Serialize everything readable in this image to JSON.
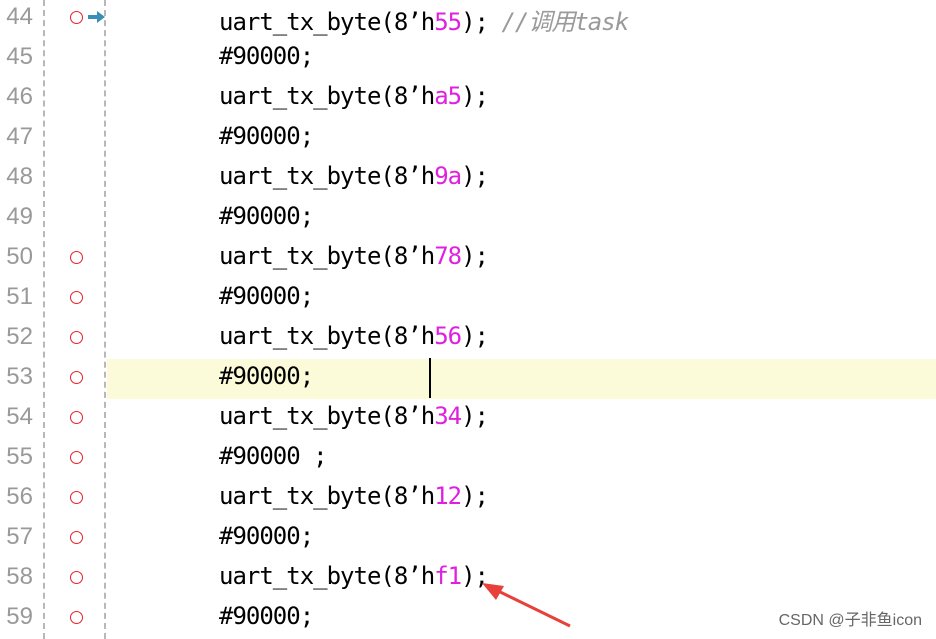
{
  "lines": [
    {
      "num": "44",
      "bp": true,
      "exec": true,
      "hl": false,
      "pre": "uart_tx_byte(8’h",
      "val": "55",
      "post": ");",
      "comment": " //调用task"
    },
    {
      "num": "45",
      "bp": false,
      "exec": false,
      "hl": false,
      "pre": "#90000;",
      "val": "",
      "post": "",
      "comment": ""
    },
    {
      "num": "46",
      "bp": false,
      "exec": false,
      "hl": false,
      "pre": "uart_tx_byte(8’h",
      "val": "a5",
      "post": ");",
      "comment": ""
    },
    {
      "num": "47",
      "bp": false,
      "exec": false,
      "hl": false,
      "pre": "#90000;",
      "val": "",
      "post": "",
      "comment": ""
    },
    {
      "num": "48",
      "bp": false,
      "exec": false,
      "hl": false,
      "pre": "uart_tx_byte(8’h",
      "val": "9a",
      "post": ");",
      "comment": ""
    },
    {
      "num": "49",
      "bp": false,
      "exec": false,
      "hl": false,
      "pre": "#90000;",
      "val": "",
      "post": "",
      "comment": ""
    },
    {
      "num": "50",
      "bp": true,
      "exec": false,
      "hl": false,
      "pre": "uart_tx_byte(8’h",
      "val": "78",
      "post": ");",
      "comment": ""
    },
    {
      "num": "51",
      "bp": true,
      "exec": false,
      "hl": false,
      "pre": "#90000;",
      "val": "",
      "post": "",
      "comment": ""
    },
    {
      "num": "52",
      "bp": true,
      "exec": false,
      "hl": false,
      "pre": "uart_tx_byte(8’h",
      "val": "56",
      "post": ");",
      "comment": ""
    },
    {
      "num": "53",
      "bp": true,
      "exec": false,
      "hl": true,
      "pre": "#90000;",
      "val": "",
      "post": "",
      "comment": ""
    },
    {
      "num": "54",
      "bp": true,
      "exec": false,
      "hl": false,
      "pre": "uart_tx_byte(8’h",
      "val": "34",
      "post": ");",
      "comment": ""
    },
    {
      "num": "55",
      "bp": true,
      "exec": false,
      "hl": false,
      "pre": "#90000 ;",
      "val": "",
      "post": "",
      "comment": ""
    },
    {
      "num": "56",
      "bp": true,
      "exec": false,
      "hl": false,
      "pre": "uart_tx_byte(8’h",
      "val": "12",
      "post": ");",
      "comment": ""
    },
    {
      "num": "57",
      "bp": true,
      "exec": false,
      "hl": false,
      "pre": "#90000;",
      "val": "",
      "post": "",
      "comment": ""
    },
    {
      "num": "58",
      "bp": true,
      "exec": false,
      "hl": false,
      "pre": "uart_tx_byte(8’h",
      "val": "f1",
      "post": ");",
      "comment": ""
    },
    {
      "num": "59",
      "bp": true,
      "exec": false,
      "hl": false,
      "pre": "#90000;",
      "val": "",
      "post": "",
      "comment": ""
    }
  ],
  "watermark": "CSDN @子非鱼icon",
  "colors": {
    "breakpoint": "#e8202a",
    "hex_value": "#e020e0",
    "current_line_bg": "#fbfbd9",
    "exec_arrow": "#3a8fb7",
    "annotation_arrow": "#e8403a"
  }
}
